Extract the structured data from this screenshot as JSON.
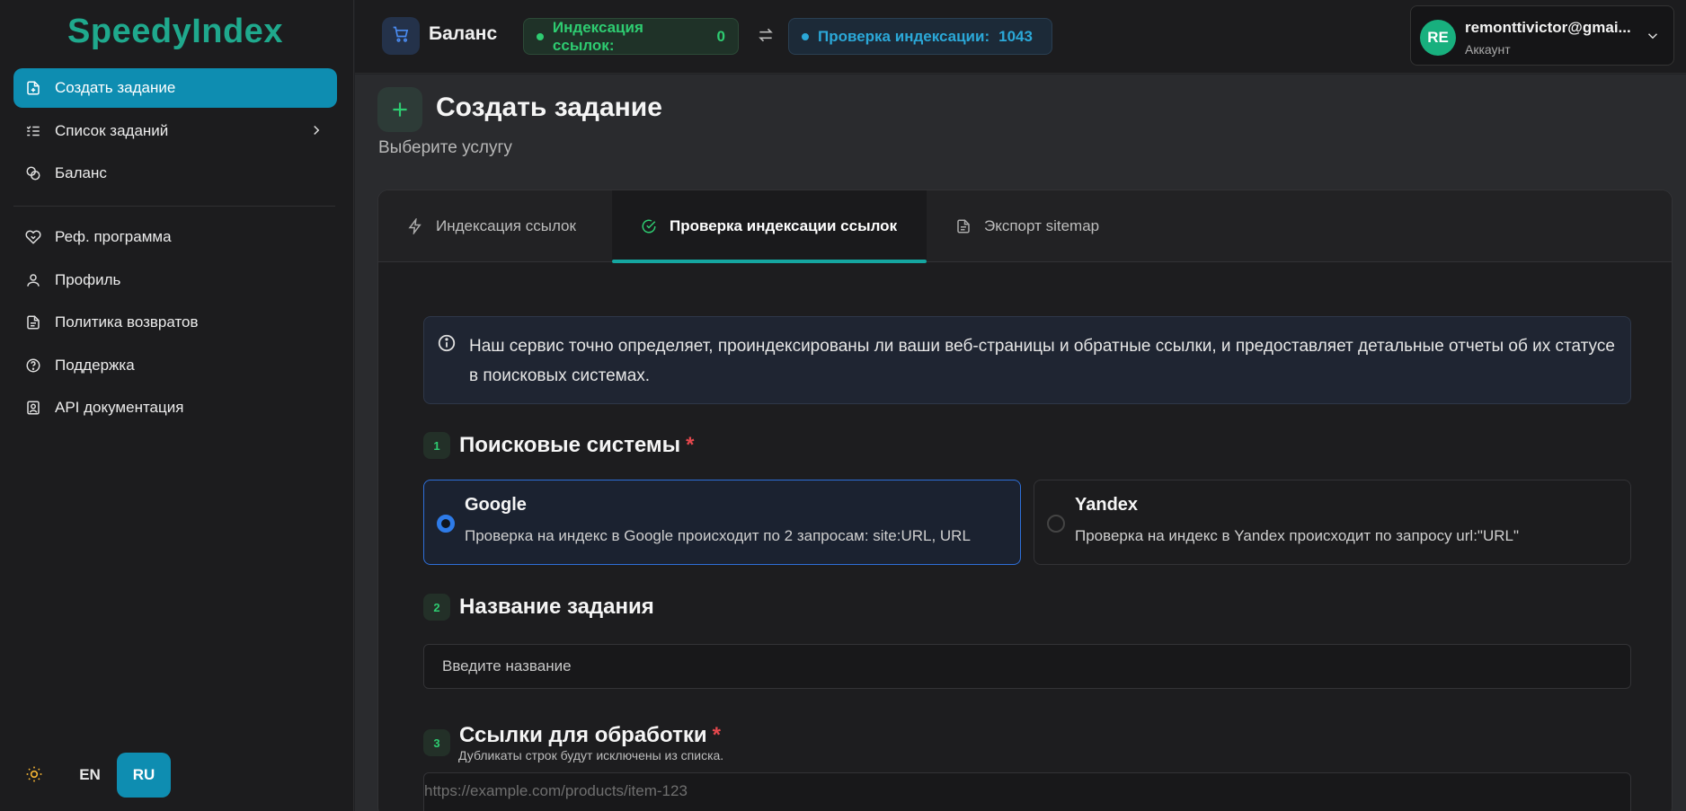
{
  "app": {
    "logo": "SpeedyIndex"
  },
  "sidebar": {
    "items": [
      {
        "label": "Создать задание"
      },
      {
        "label": "Список заданий"
      },
      {
        "label": "Баланс"
      },
      {
        "label": "Реф. программа"
      },
      {
        "label": "Профиль"
      },
      {
        "label": "Политика возвратов"
      },
      {
        "label": "Поддержка"
      },
      {
        "label": "API документация"
      }
    ],
    "languages": [
      "EN",
      "RU"
    ],
    "active_language": "RU"
  },
  "header": {
    "balance_title": "Баланс",
    "indexing_label": "Индексация ссылок:",
    "indexing_value": "0",
    "check_label": "Проверка индексации:",
    "check_value": "1043",
    "account_email": "remonttivictor@gmai...",
    "account_sub": "Аккаунт",
    "avatar_initials": "RE"
  },
  "main": {
    "title": "Создать задание",
    "subtitle": "Выберите услугу",
    "tabs": [
      {
        "label": "Индексация ссылок"
      },
      {
        "label": "Проверка индексации ссылок"
      },
      {
        "label": "Экспорт sitemap"
      }
    ],
    "info": "Наш сервис точно определяет, проиндексированы ли ваши веб-страницы и обратные ссылки, и предоставляет детальные отчеты об их статусе в поисковых системах.",
    "step1": {
      "num": "1",
      "title": "Поисковые системы",
      "required": "*"
    },
    "engines": [
      {
        "title": "Google",
        "desc": "Проверка на индекс в Google происходит по 2 запросам: site:URL, URL"
      },
      {
        "title": "Yandex",
        "desc": "Проверка на индекс в Yandex происходит по запросу url:\"URL\""
      }
    ],
    "step2": {
      "num": "2",
      "title": "Название задания"
    },
    "name_placeholder": "Введите название",
    "step3": {
      "num": "3",
      "title": "Ссылки для обработки",
      "required": "*"
    },
    "links_note": "Дубликаты строк будут исключены из списка.",
    "links_placeholder": "https://example.com/products/item-123"
  },
  "colors": {
    "accent": "#0e8db1",
    "brand": "#1fa98d",
    "success": "#2ecc71",
    "info": "#2ba8d8",
    "required": "#e5484d"
  }
}
